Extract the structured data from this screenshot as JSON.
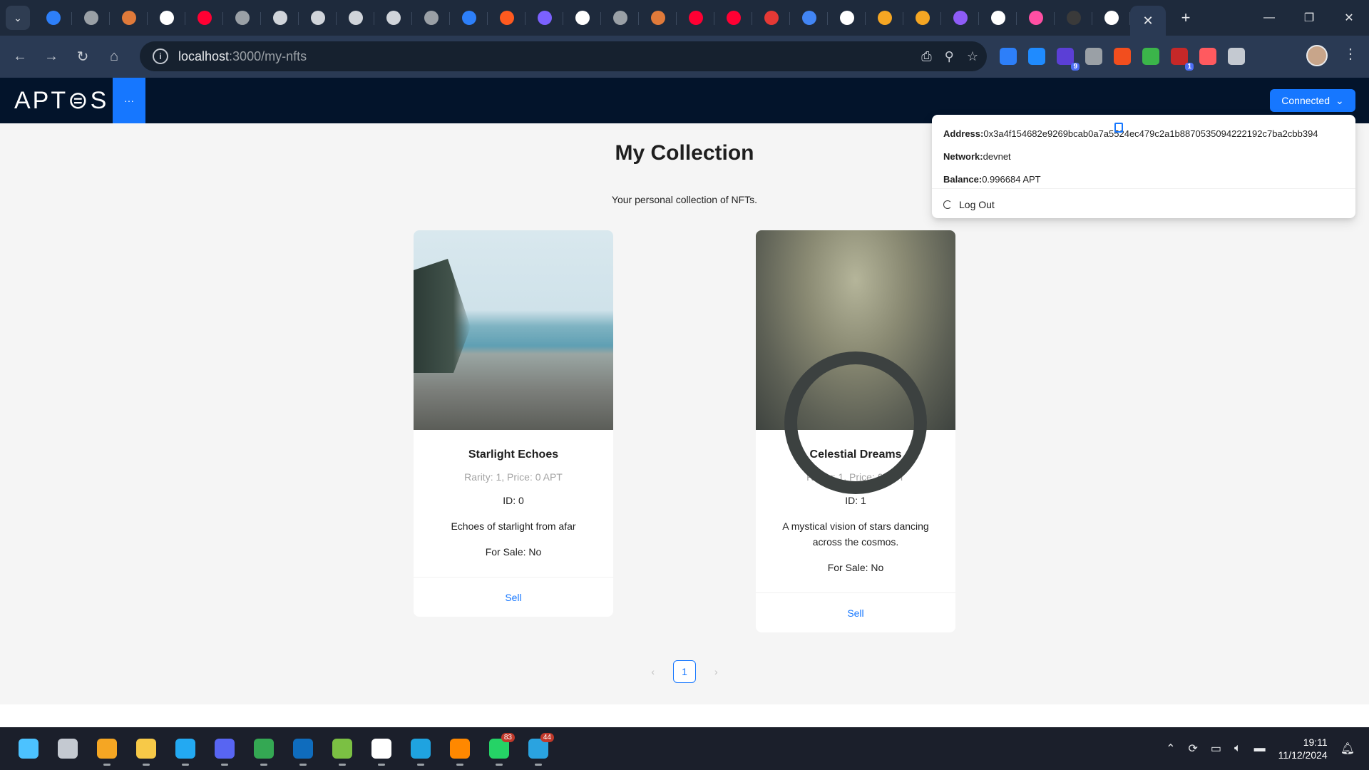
{
  "browser": {
    "url_host": "localhost",
    "url_path": ":3000/my-nfts",
    "tabs": [
      {
        "icon": "diamond-icon",
        "color": "#2d7ff9"
      },
      {
        "icon": "globe-icon",
        "color": "#9aa0a6"
      },
      {
        "icon": "avatar-icon",
        "color": "#e07a3a"
      },
      {
        "icon": "onlyfans-icon",
        "color": "#ffffff"
      },
      {
        "icon": "youtube-icon",
        "color": "#ff0033"
      },
      {
        "icon": "loading-icon",
        "color": "#9aa0a6"
      },
      {
        "icon": "wordpress-icon",
        "color": "#d0d4da"
      },
      {
        "icon": "wordpress-icon",
        "color": "#d0d4da"
      },
      {
        "icon": "wordpress-icon",
        "color": "#d0d4da"
      },
      {
        "icon": "wordpress-icon",
        "color": "#d0d4da"
      },
      {
        "icon": "globe-icon",
        "color": "#9aa0a6"
      },
      {
        "icon": "info-icon",
        "color": "#2d7ff9"
      },
      {
        "icon": "x-icon",
        "color": "#ff5a1f"
      },
      {
        "icon": "sphere-icon",
        "color": "#7b61ff"
      },
      {
        "icon": "github-icon",
        "color": "#ffffff"
      },
      {
        "icon": "loading-icon",
        "color": "#9aa0a6"
      },
      {
        "icon": "avatar-icon",
        "color": "#e07a3a"
      },
      {
        "icon": "youtube-icon",
        "color": "#ff0033"
      },
      {
        "icon": "youtube-icon",
        "color": "#ff0033"
      },
      {
        "icon": "gauge-icon",
        "color": "#e53935"
      },
      {
        "icon": "translate-icon",
        "color": "#4285f4"
      },
      {
        "icon": "openai-icon",
        "color": "#ffffff"
      },
      {
        "icon": "star-icon",
        "color": "#f5a623"
      },
      {
        "icon": "star-icon",
        "color": "#f5a623"
      },
      {
        "icon": "app-icon",
        "color": "#8e5cf7"
      },
      {
        "icon": "openai-icon",
        "color": "#ffffff"
      },
      {
        "icon": "pill-icon",
        "color": "#ff4fa3"
      },
      {
        "icon": "flag-icon",
        "color": "#3a3a3a"
      },
      {
        "icon": "github-icon",
        "color": "#ffffff"
      }
    ],
    "extensions": [
      {
        "icon": "gem-extension-icon",
        "color": "#2d7ff9",
        "badge": ""
      },
      {
        "icon": "shazam-extension-icon",
        "color": "#1f8bff",
        "badge": ""
      },
      {
        "icon": "wallet-extension-icon",
        "color": "#5b3fd6",
        "badge": "9"
      },
      {
        "icon": "zoom-extension-icon",
        "color": "#9aa0a6",
        "badge": ""
      },
      {
        "icon": "figma-extension-icon",
        "color": "#f24e1e",
        "badge": ""
      },
      {
        "icon": "colorful-extension-icon",
        "color": "#3bb54a",
        "badge": ""
      },
      {
        "icon": "red-extension-icon",
        "color": "#c62828",
        "badge": "1"
      },
      {
        "icon": "p-extension-icon",
        "color": "#ff5a5f",
        "badge": ""
      },
      {
        "icon": "puzzle-extension-icon",
        "color": "#c4c9d1",
        "badge": ""
      }
    ]
  },
  "app": {
    "logo": "APT⊜S",
    "menu_label": "···",
    "connected_label": "Connected",
    "wallet": {
      "address_label": "Address:",
      "address": "0x3a4f154682e9269bcab0a7a5524ec479c2a1b8870535094222192c7ba2cbb394",
      "network_label": "Network:",
      "network": "devnet",
      "balance_label": "Balance:",
      "balance": "0.996684 APT",
      "logout_label": "Log Out"
    }
  },
  "main": {
    "title": "My Collection",
    "subtitle": "Your personal collection of NFTs.",
    "nfts": [
      {
        "name": "Starlight Echoes",
        "meta": "Rarity: 1, Price: 0 APT",
        "id": "ID: 0",
        "description": "Echoes of starlight from afar",
        "for_sale": "For Sale: No",
        "action": "Sell"
      },
      {
        "name": "Celestial Dreams",
        "meta": "Rarity: 1, Price: 0 APT",
        "id": "ID: 1",
        "description": "A mystical vision of stars dancing across the cosmos.",
        "for_sale": "For Sale: No",
        "action": "Sell"
      }
    ],
    "pagination": {
      "current": "1",
      "prev": "‹",
      "next": "›"
    }
  },
  "taskbar": {
    "apps": [
      {
        "icon": "windows-start-icon",
        "color": "#4cc2ff",
        "count": ""
      },
      {
        "icon": "task-view-icon",
        "color": "#c4c9d1",
        "count": ""
      },
      {
        "icon": "search-icon",
        "color": "#f5a623",
        "count": ""
      },
      {
        "icon": "file-explorer-icon",
        "color": "#f7c948",
        "count": ""
      },
      {
        "icon": "vscode-icon",
        "color": "#23a9f2",
        "count": ""
      },
      {
        "icon": "discord-icon",
        "color": "#5865f2",
        "count": ""
      },
      {
        "icon": "chrome-icon",
        "color": "#34a853",
        "count": ""
      },
      {
        "icon": "outlook-icon",
        "color": "#0f6cbd",
        "count": ""
      },
      {
        "icon": "colorful-app-icon",
        "color": "#7bc043",
        "count": ""
      },
      {
        "icon": "notion-icon",
        "color": "#ffffff",
        "count": ""
      },
      {
        "icon": "edge-icon",
        "color": "#1fa3e0",
        "count": ""
      },
      {
        "icon": "vlc-icon",
        "color": "#ff8800",
        "count": ""
      },
      {
        "icon": "whatsapp-icon",
        "color": "#25d366",
        "count": "83"
      },
      {
        "icon": "telegram-icon",
        "color": "#2aa3e0",
        "count": "44"
      }
    ],
    "time": "19:11",
    "date": "11/12/2024"
  }
}
